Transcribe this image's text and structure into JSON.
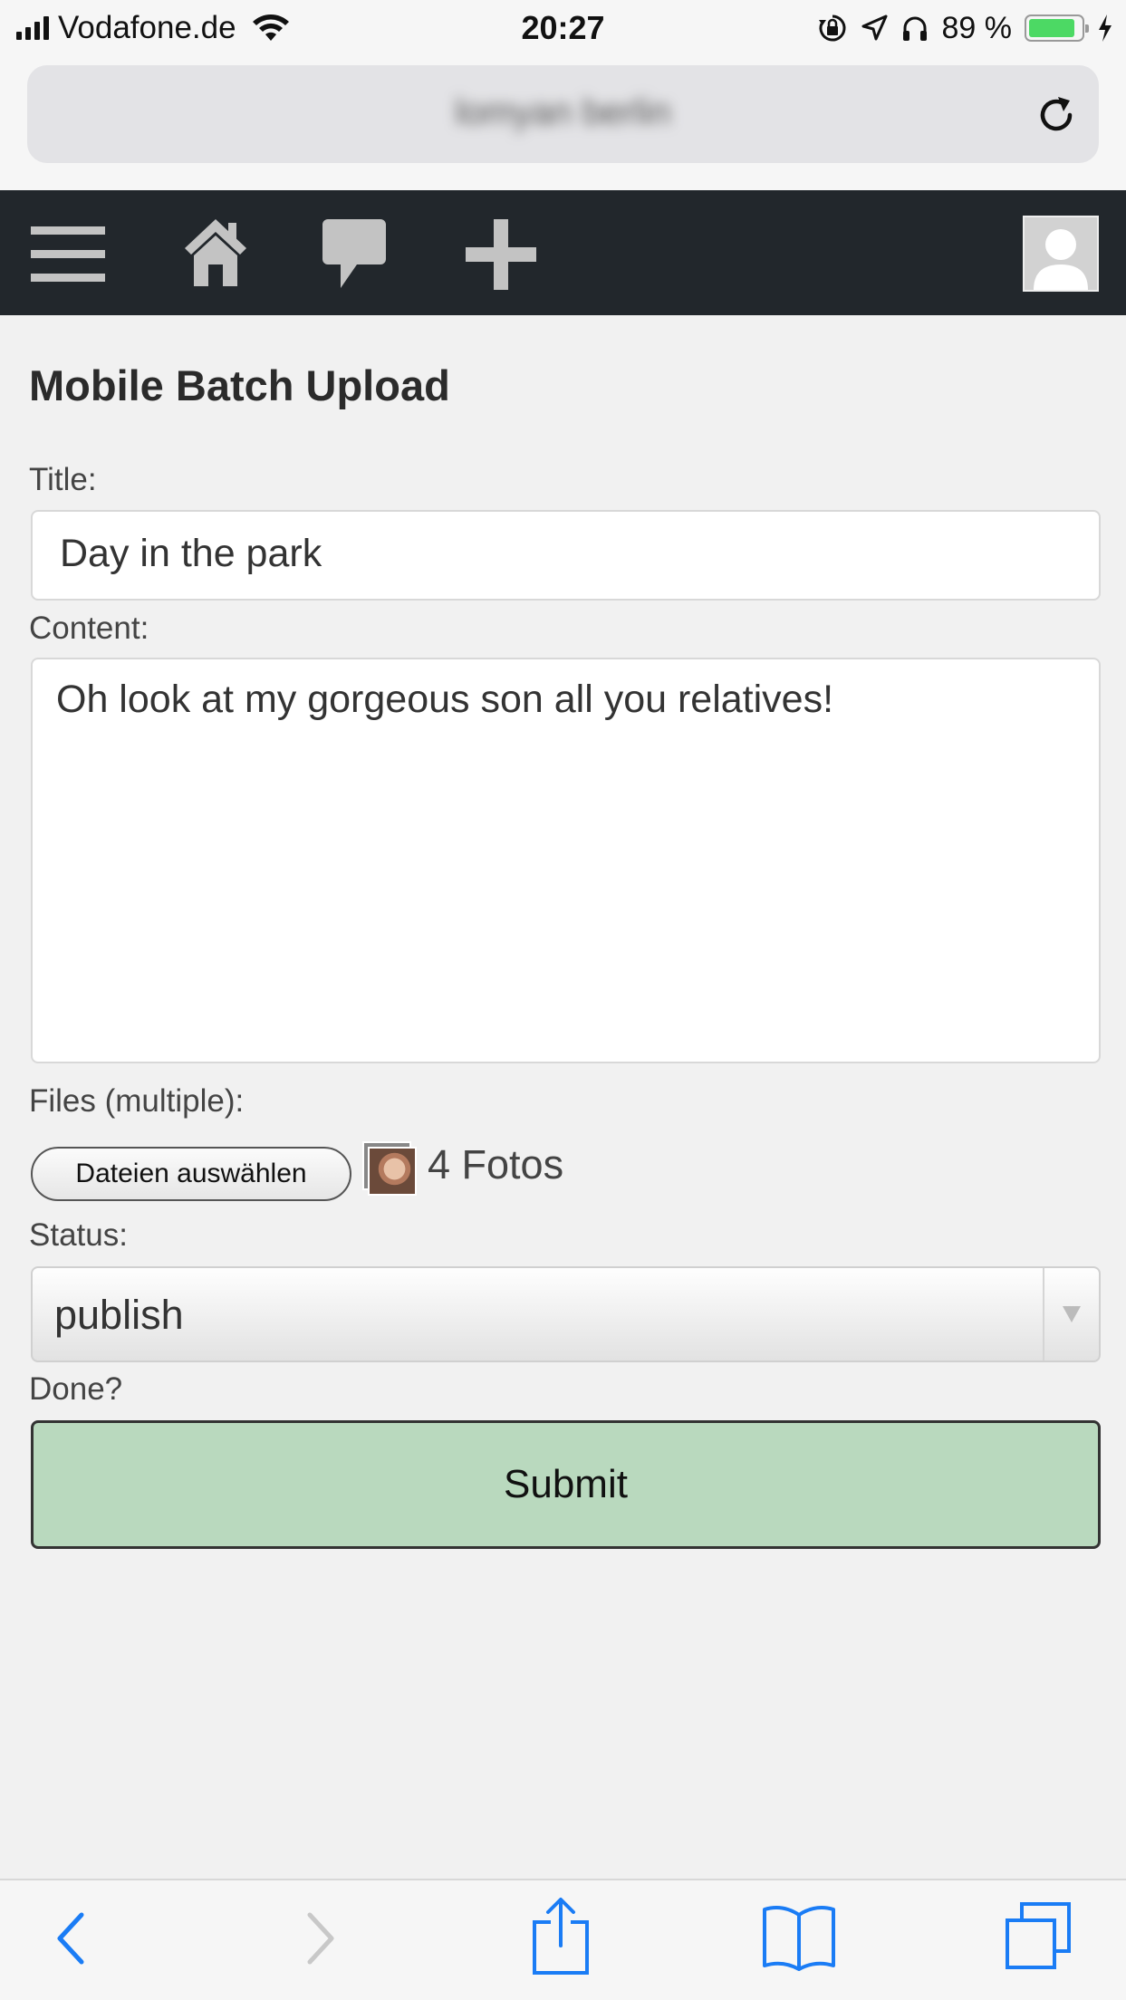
{
  "status_bar": {
    "carrier": "Vodafone.de",
    "time": "20:27",
    "battery_percent": "89 %",
    "battery_level": 0.89,
    "icons": [
      "signal-icon",
      "wifi-icon",
      "rotation-lock-icon",
      "location-icon",
      "headphones-icon",
      "battery-icon",
      "charging-icon"
    ]
  },
  "browser": {
    "url_text": "lomyan berlin",
    "reload_icon": "reload-icon"
  },
  "nav": {
    "icons": [
      "menu-icon",
      "home-icon",
      "comment-icon",
      "plus-icon",
      "avatar"
    ]
  },
  "form": {
    "heading": "Mobile Batch Upload",
    "title_label": "Title:",
    "title_value": "Day in the park",
    "content_label": "Content:",
    "content_value": "Oh look at my gorgeous son all you relatives!",
    "files_label": "Files (multiple):",
    "file_button_label": "Dateien auswählen",
    "file_count": "4 Fotos",
    "status_label": "Status:",
    "status_value": "publish",
    "done_label": "Done?",
    "submit_label": "Submit"
  },
  "toolbar": {
    "icons": [
      "back-icon",
      "forward-icon",
      "share-icon",
      "bookmarks-icon",
      "tabs-icon"
    ],
    "accent_color": "#1a7cf5",
    "disabled_color": "#c8c8c8"
  },
  "colors": {
    "nav_background": "#22272c",
    "submit_background": "#b9d9be",
    "page_background": "#f1f1f1"
  }
}
